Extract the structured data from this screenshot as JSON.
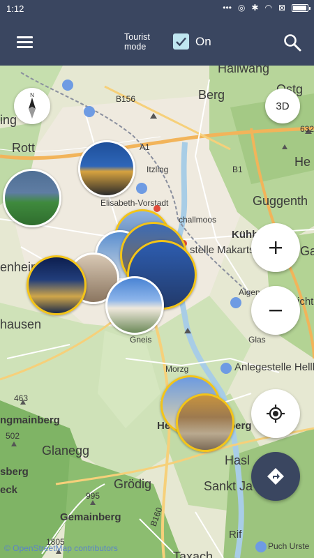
{
  "status_bar": {
    "time": "1:12"
  },
  "app_bar": {
    "menu_icon": "hamburger-menu-icon",
    "tourist_mode_label_line1": "Tourist",
    "tourist_mode_label_line2": "mode",
    "tourist_mode_checked": true,
    "toggle_label": "On",
    "search_icon": "search-icon"
  },
  "map": {
    "labels": {
      "hallwang": "Hallwang",
      "berg": "Berg",
      "b156": "B156",
      "ing": "ing",
      "rott": "Rott",
      "a1": "A1",
      "itzling": "Itzling",
      "elisabeth_vorstadt": "Elisabeth-Vorstadt",
      "schallmoos": "challmoos",
      "guggenth": "Guggenth",
      "b1": "B1",
      "kuhb": "Kühb",
      "ste_makart": "stelle Makartst",
      "enheim": "enheim",
      "aigen": "Aigen",
      "eichts": "ichts",
      "hausen": "hausen",
      "gneis": "Gneis",
      "glas": "Glas",
      "morzg": "Morzg",
      "anlegestelle": "Anlegestelle Hellb",
      "he_berg": "He",
      "he_berg2": "berg",
      "n463": "463",
      "ingmainberg": "ngmainberg",
      "n502": "502",
      "glanegg": "Glanegg",
      "sberg": "sberg",
      "grodig": "Grödig",
      "hasl": "Hasl",
      "sankt_ja": "Sankt Ja",
      "eck": "eck",
      "n995": "995",
      "gemainberg": "Gemainberg",
      "b160": "B160",
      "rif": "Rif",
      "n1805": "1805",
      "puch": "Puch Urste",
      "taxach": "Taxach",
      "ostg": "Ostg",
      "he_right": "He",
      "ga": "Ga",
      "n632": "632"
    },
    "attribution": "© OpenStreetMap contributors"
  },
  "controls": {
    "three_d_label": "3D",
    "zoom_in_icon": "plus-icon",
    "zoom_out_icon": "minus-icon",
    "locate_icon": "my-location-icon",
    "route_icon": "directions-icon",
    "compass_icon": "compass-icon"
  },
  "colors": {
    "app_bar": "#3a4660",
    "checkbox": "#bfe6f1",
    "marker_border_gold": "#f3c418",
    "route_fab": "#3a4660"
  }
}
